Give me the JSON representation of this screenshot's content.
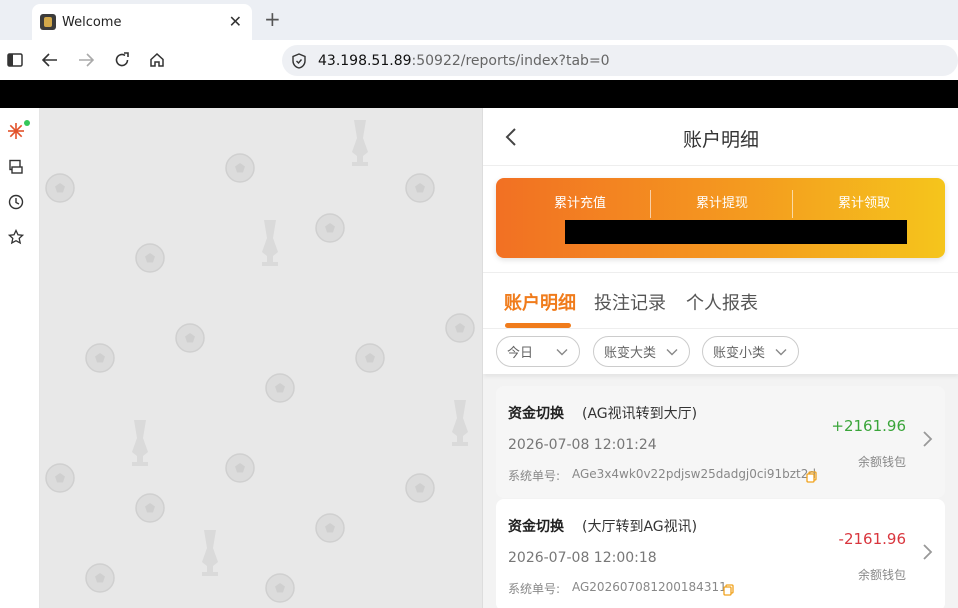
{
  "browser": {
    "tab_title": "Welcome",
    "new_tab": "+",
    "close": "✕",
    "url_host": "43.198.51.89",
    "url_rest": ":50922/reports/index?tab=0"
  },
  "header": {
    "title": "账户明细"
  },
  "summary": {
    "labels": [
      "累计充值",
      "累计提现",
      "累计领取"
    ],
    "colors": {
      "start": "#f27023",
      "end": "#f5c51c"
    }
  },
  "tabs": [
    {
      "label": "账户明细",
      "active": true
    },
    {
      "label": "投注记录",
      "active": false
    },
    {
      "label": "个人报表",
      "active": false
    }
  ],
  "filters": [
    {
      "label": "今日"
    },
    {
      "label": "账变大类"
    },
    {
      "label": "账变小类"
    }
  ],
  "records": [
    {
      "type": "资金切换",
      "detail": "(AG视讯转到大厅)",
      "time": "2026-07-08 12:01:24",
      "order_label": "系统单号:",
      "order_no": "AGe3x4wk0v22pdjsw25dadgj0ci91bzt2d",
      "amount": "+2161.96",
      "amount_color": "#3aa53a",
      "wallet": "余额钱包"
    },
    {
      "type": "资金切换",
      "detail": "(大厅转到AG视讯)",
      "time": "2026-07-08 12:00:18",
      "order_label": "系统单号:",
      "order_no": "AG202607081200184311",
      "amount": "-2161.96",
      "amount_color": "#d9363e",
      "wallet": "余额钱包"
    }
  ],
  "accent": "#f07c1c"
}
